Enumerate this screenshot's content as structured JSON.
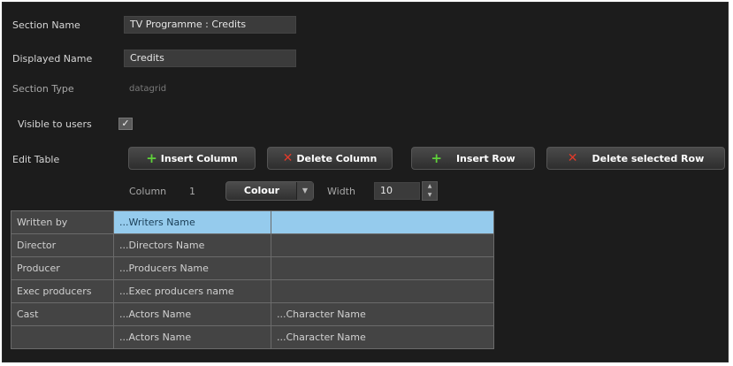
{
  "form": {
    "section_name_label": "Section Name",
    "section_name_value": "TV Programme : Credits",
    "displayed_name_label": "Displayed Name",
    "displayed_name_value": "Credits",
    "section_type_label": "Section Type",
    "section_type_value": "datagrid",
    "visible_label": "Visible to users",
    "visible_checked": "✓",
    "edit_table_label": "Edit Table"
  },
  "toolbar": {
    "insert_column": "Insert Column",
    "delete_column": "Delete Column",
    "insert_row": "Insert Row",
    "delete_row": "Delete selected Row"
  },
  "column_editor": {
    "column_label": "Column",
    "column_index": "1",
    "type_value": "Colour",
    "width_label": "Width",
    "width_value": "10"
  },
  "table": {
    "rows": [
      [
        "Written by",
        "...Writers Name",
        ""
      ],
      [
        "Director",
        "...Directors Name",
        ""
      ],
      [
        "Producer",
        "...Producers Name",
        ""
      ],
      [
        "Exec producers",
        "...Exec producers name",
        ""
      ],
      [
        "Cast",
        "...Actors Name",
        "...Character Name"
      ],
      [
        "",
        "...Actors Name",
        "...Character Name"
      ]
    ]
  }
}
